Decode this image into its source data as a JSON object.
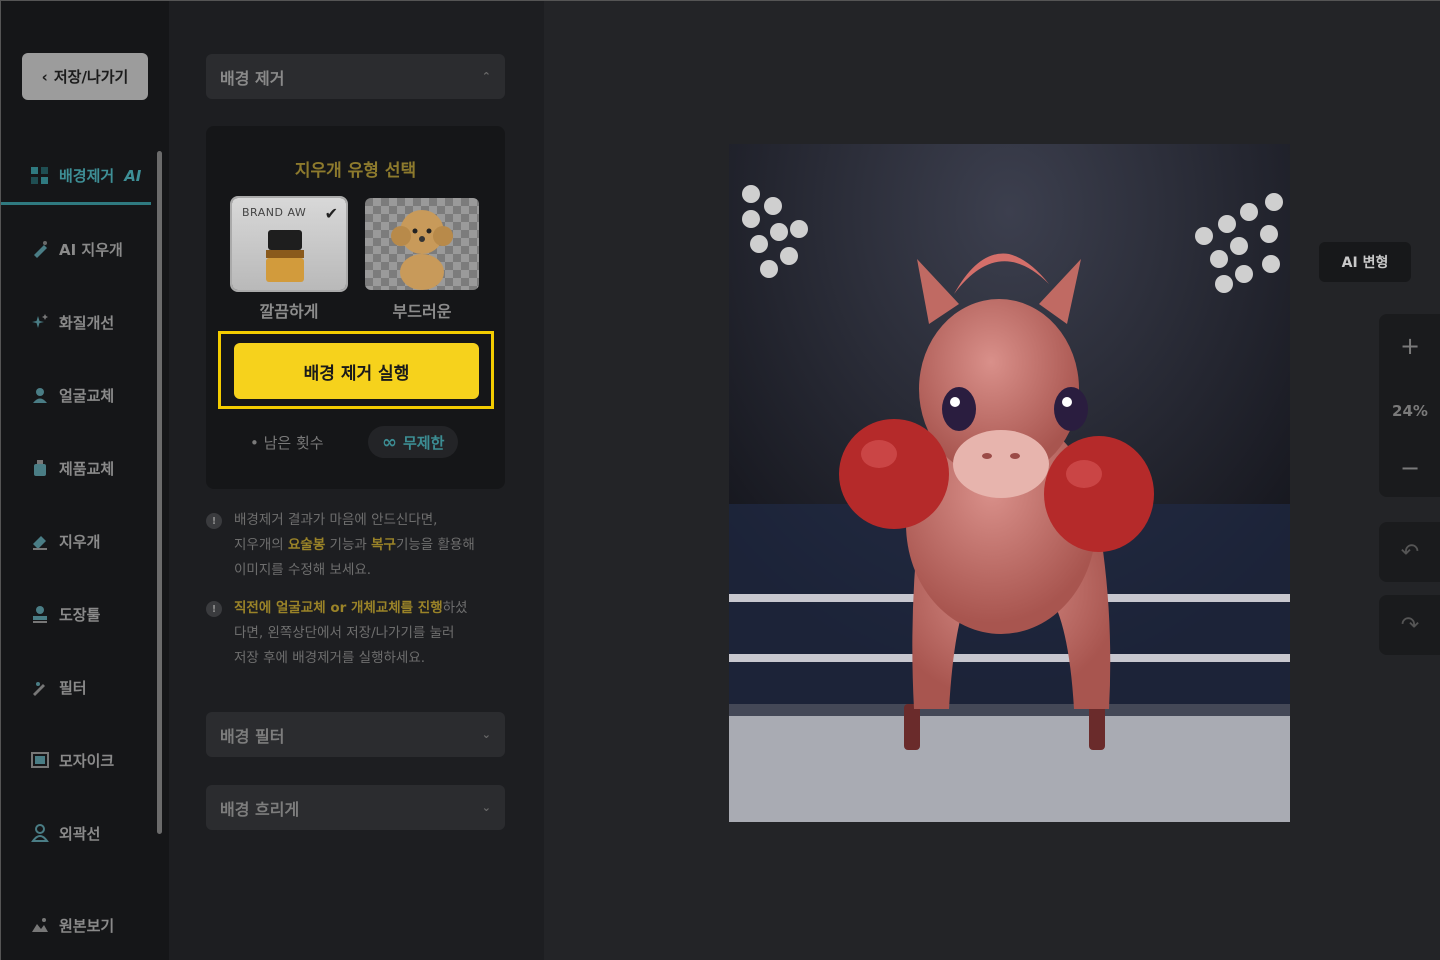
{
  "header": {
    "back_label": "저장/나가기"
  },
  "sidebar": {
    "items": [
      {
        "label": "배경제거",
        "tag": "AI"
      },
      {
        "label": "AI 지우개"
      },
      {
        "label": "화질개선"
      },
      {
        "label": "얼굴교체"
      },
      {
        "label": "제품교체"
      },
      {
        "label": "지우개"
      },
      {
        "label": "도장툴"
      },
      {
        "label": "필터"
      },
      {
        "label": "모자이크"
      },
      {
        "label": "외곽선"
      },
      {
        "label": "원본보기"
      }
    ]
  },
  "panel": {
    "section_title": "배경 제거",
    "card": {
      "title": "지우개 유형 선택",
      "options": [
        {
          "label": "깔끔하게",
          "thumb_text": "BRAND AW",
          "selected": true
        },
        {
          "label": "부드러운",
          "selected": false
        }
      ],
      "run_button": "배경 제거 실행",
      "remaining_label": "• 남은 횟수",
      "remaining_value": "무제한"
    },
    "notes": [
      {
        "p1": "배경제거 결과가 마음에 안드신다면,",
        "p2": "지우개의 ",
        "h1": "요술봉",
        "p3": " 기능과 ",
        "h2": "복구",
        "p4": "기능을 활용해",
        "p5": "이미지를 수정해 보세요."
      },
      {
        "h1": "직전에 얼굴교체 or 개체교체를 진행",
        "p1": "하셨",
        "p2": "다면, 왼쪽상단에서 저장/나가기를 눌러",
        "p3": "저장 후에 배경제거를 실행하세요."
      }
    ],
    "bg_filter": "배경 필터",
    "bg_blur": "배경 흐리게"
  },
  "canvas": {
    "ai_transform": "AI 변형",
    "zoom_in": "+",
    "zoom_level": "24%",
    "zoom_out": "−"
  },
  "colors": {
    "accent_yellow": "#f6d21c",
    "accent_teal": "#3e8f96"
  }
}
